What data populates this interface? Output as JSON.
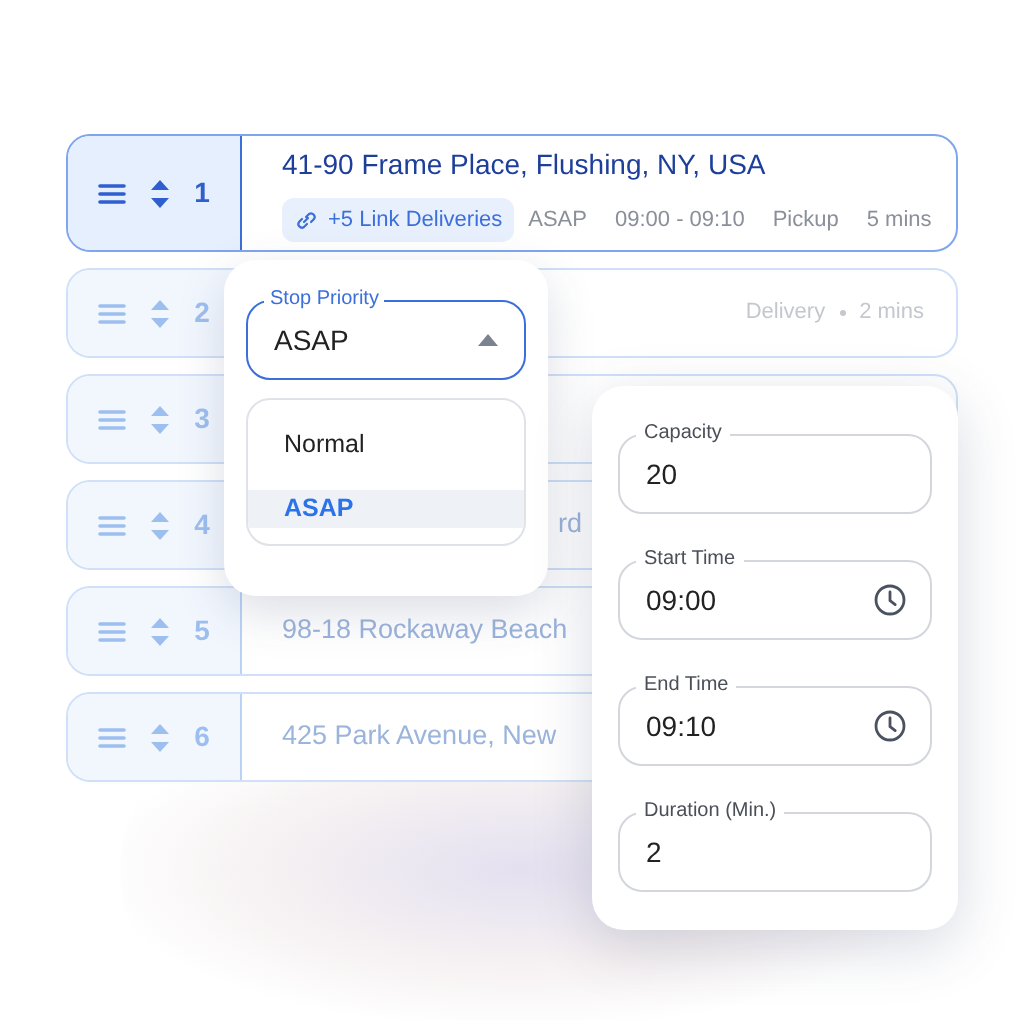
{
  "stops": [
    {
      "number": "1",
      "selected": true,
      "title": "41-90 Frame Place, Flushing, NY, USA",
      "badge": "+5 Link Deliveries",
      "meta": [
        "ASAP",
        "09:00 - 09:10",
        "Pickup",
        "5 mins"
      ]
    },
    {
      "number": "2",
      "selected": false,
      "meta": [
        "Delivery",
        "2 mins"
      ]
    },
    {
      "number": "3",
      "selected": false
    },
    {
      "number": "4",
      "selected": false,
      "title": "rd",
      "clipped": true
    },
    {
      "number": "5",
      "selected": false,
      "title": "98-18 Rockaway Beach"
    },
    {
      "number": "6",
      "selected": false,
      "title": "425 Park Avenue, New"
    }
  ],
  "priority": {
    "label": "Stop Priority",
    "value": "ASAP",
    "expanded": true,
    "options": [
      {
        "label": "Normal",
        "selected": false
      },
      {
        "label": "ASAP",
        "selected": true
      }
    ]
  },
  "form": [
    {
      "kind": "text",
      "label": "Capacity",
      "value": "20"
    },
    {
      "kind": "time",
      "label": "Start Time",
      "value": "09:00"
    },
    {
      "kind": "time",
      "label": "End Time",
      "value": "09:10"
    },
    {
      "kind": "text",
      "label": "Duration (Min.)",
      "value": "2"
    }
  ]
}
